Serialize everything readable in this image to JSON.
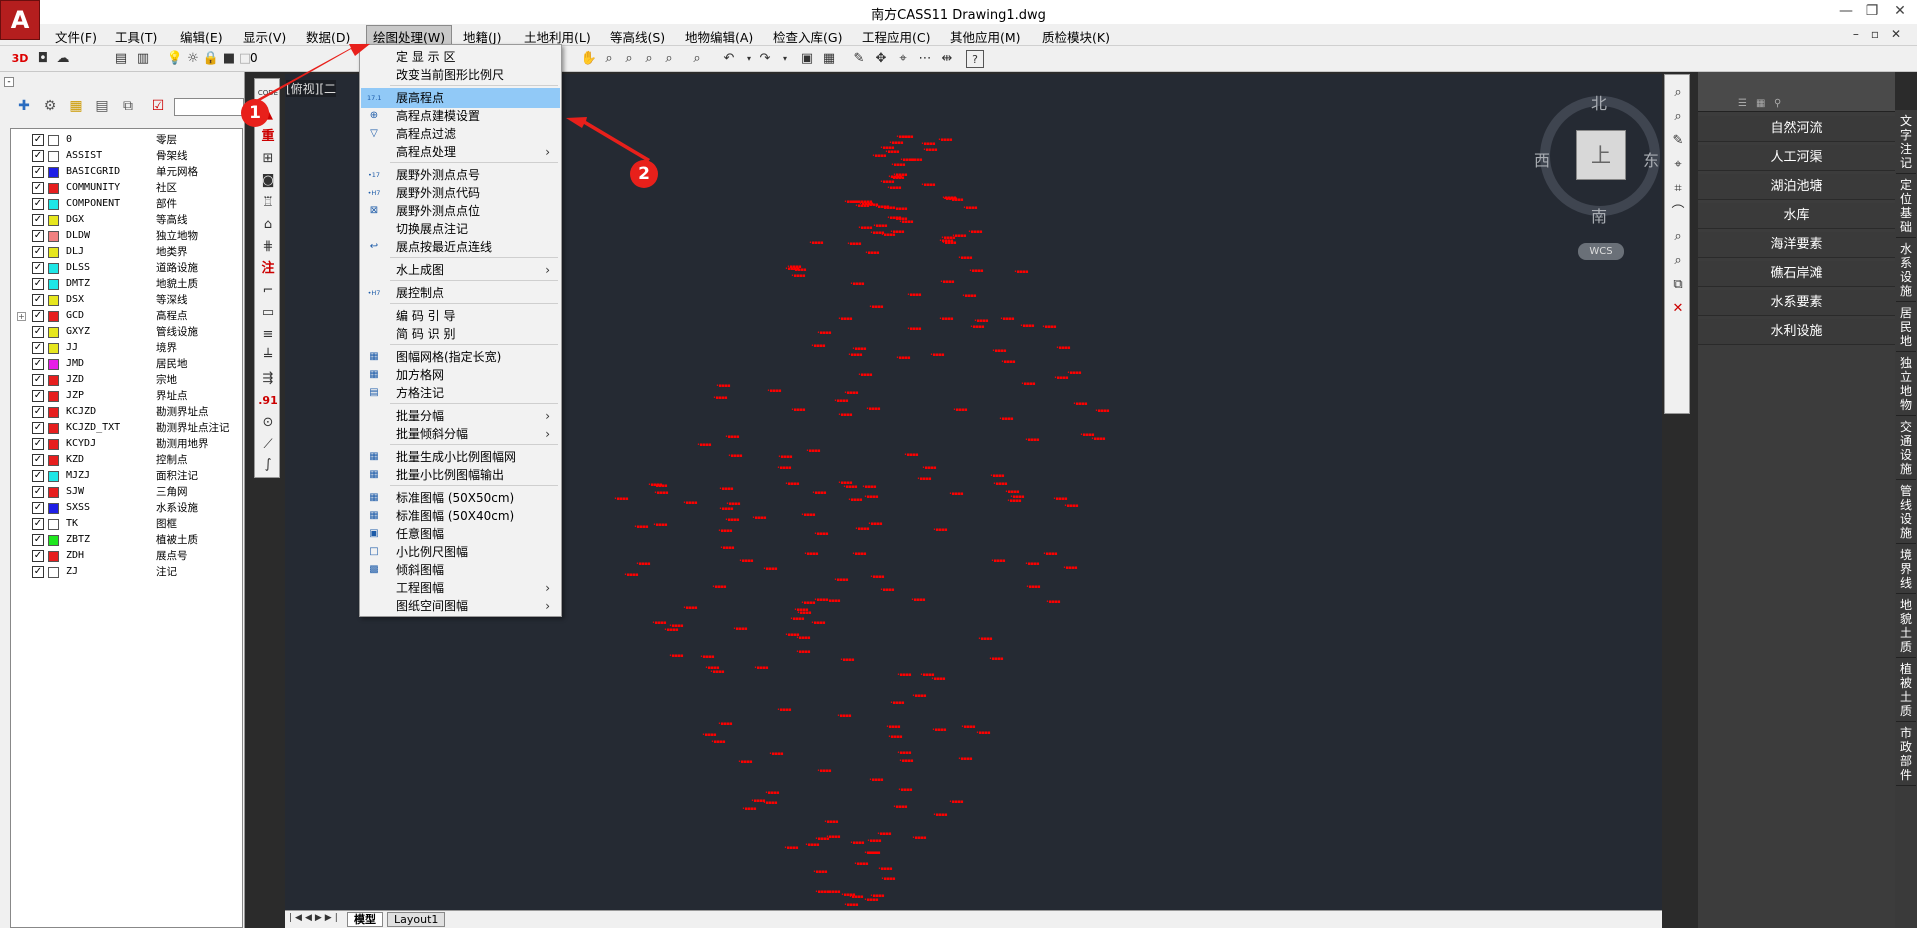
{
  "window": {
    "title": "南方CASS11    Drawing1.dwg"
  },
  "menubar": {
    "items": [
      "文件(F)",
      "工具(T)",
      "编辑(E)",
      "显示(V)",
      "数据(D)",
      "绘图处理(W)",
      "地籍(J)",
      "土地利用(L)",
      "等高线(S)",
      "地物编辑(A)",
      "检查入库(G)",
      "工程应用(C)",
      "其他应用(M)",
      "质检模块(K)"
    ],
    "active": "绘图处理(W)"
  },
  "toolbar": {
    "mode_3d": "3D",
    "layer_value": "0"
  },
  "layers": [
    {
      "name": "0",
      "desc": "零层",
      "color": "#ffffff"
    },
    {
      "name": "ASSIST",
      "desc": "骨架线",
      "color": "#ffffff"
    },
    {
      "name": "BASICGRID",
      "desc": "单元网格",
      "color": "#1e1ee6"
    },
    {
      "name": "COMMUNITY",
      "desc": "社区",
      "color": "#e61e1e"
    },
    {
      "name": "COMPONENT",
      "desc": "部件",
      "color": "#1ee6e6"
    },
    {
      "name": "DGX",
      "desc": "等高线",
      "color": "#e6e61e"
    },
    {
      "name": "DLDW",
      "desc": "独立地物",
      "color": "#f08080"
    },
    {
      "name": "DLJ",
      "desc": "地类界",
      "color": "#e6e61e"
    },
    {
      "name": "DLSS",
      "desc": "道路设施",
      "color": "#1ee6e6"
    },
    {
      "name": "DMTZ",
      "desc": "地貌土质",
      "color": "#1ee6e6"
    },
    {
      "name": "DSX",
      "desc": "等深线",
      "color": "#e6e61e"
    },
    {
      "name": "GCD",
      "desc": "高程点",
      "color": "#e61e1e"
    },
    {
      "name": "GXYZ",
      "desc": "管线设施",
      "color": "#e6e61e"
    },
    {
      "name": "JJ",
      "desc": "境界",
      "color": "#e6e61e"
    },
    {
      "name": "JMD",
      "desc": "居民地",
      "color": "#e61ee6"
    },
    {
      "name": "JZD",
      "desc": "宗地",
      "color": "#e61e1e"
    },
    {
      "name": "JZP",
      "desc": "界址点",
      "color": "#e61e1e"
    },
    {
      "name": "KCJZD",
      "desc": "勘测界址点",
      "color": "#e61e1e"
    },
    {
      "name": "KCJZD_TXT",
      "desc": "勘测界址点注记",
      "color": "#e61e1e"
    },
    {
      "name": "KCYDJ",
      "desc": "勘测用地界",
      "color": "#e61e1e"
    },
    {
      "name": "KZD",
      "desc": "控制点",
      "color": "#e61e1e"
    },
    {
      "name": "MJZJ",
      "desc": "面积注记",
      "color": "#1ee6e6"
    },
    {
      "name": "SJW",
      "desc": "三角网",
      "color": "#e61e1e"
    },
    {
      "name": "SXSS",
      "desc": "水系设施",
      "color": "#1e1ee6"
    },
    {
      "name": "TK",
      "desc": "图框",
      "color": "#ffffff"
    },
    {
      "name": "ZBTZ",
      "desc": "植被土质",
      "color": "#1ee61e"
    },
    {
      "name": "ZDH",
      "desc": "展点号",
      "color": "#e61e1e"
    },
    {
      "name": "ZJ",
      "desc": "注记",
      "color": "#ffffff"
    }
  ],
  "viewport": {
    "label": "[俯视][二"
  },
  "viewcube": {
    "north": "北",
    "south": "南",
    "east": "东",
    "west": "西",
    "face": "上",
    "wcs": "WCS"
  },
  "tabs": [
    "模型",
    "Layout1"
  ],
  "dropdown": {
    "items": [
      {
        "label": "定 显 示 区",
        "icon": "",
        "submenu": false,
        "highlight": false
      },
      {
        "label": "改变当前图形比例尺",
        "icon": "",
        "submenu": false,
        "highlight": false
      },
      {
        "sep": true
      },
      {
        "label": "展高程点",
        "icon": "17.1",
        "submenu": false,
        "highlight": true
      },
      {
        "label": "高程点建模设置",
        "icon": "⊕",
        "submenu": false,
        "highlight": false
      },
      {
        "label": "高程点过滤",
        "icon": "▽",
        "submenu": false,
        "highlight": false
      },
      {
        "label": "高程点处理",
        "icon": "",
        "submenu": true,
        "highlight": false
      },
      {
        "sep": true
      },
      {
        "label": "展野外测点点号",
        "icon": "•17",
        "submenu": false,
        "highlight": false
      },
      {
        "label": "展野外测点代码",
        "icon": "•H7",
        "submenu": false,
        "highlight": false
      },
      {
        "label": "展野外测点点位",
        "icon": "⊠",
        "submenu": false,
        "highlight": false
      },
      {
        "label": "切换展点注记",
        "icon": "",
        "submenu": false,
        "highlight": false
      },
      {
        "label": "展点按最近点连线",
        "icon": "↩",
        "submenu": false,
        "highlight": false
      },
      {
        "sep": true
      },
      {
        "label": "水上成图",
        "icon": "",
        "submenu": true,
        "highlight": false
      },
      {
        "sep": true
      },
      {
        "label": "展控制点",
        "icon": "•H7",
        "submenu": false,
        "highlight": false
      },
      {
        "sep": true
      },
      {
        "label": "编 码 引 导",
        "icon": "",
        "submenu": false,
        "highlight": false
      },
      {
        "label": "简 码 识 别",
        "icon": "",
        "submenu": false,
        "highlight": false
      },
      {
        "sep": true
      },
      {
        "label": "图幅网格(指定长宽)",
        "icon": "▦",
        "submenu": false,
        "highlight": false
      },
      {
        "label": "加方格网",
        "icon": "▦",
        "submenu": false,
        "highlight": false
      },
      {
        "label": "方格注记",
        "icon": "▤",
        "submenu": false,
        "highlight": false
      },
      {
        "sep": true
      },
      {
        "label": "批量分幅",
        "icon": "",
        "submenu": true,
        "highlight": false
      },
      {
        "label": "批量倾斜分幅",
        "icon": "",
        "submenu": true,
        "highlight": false
      },
      {
        "sep": true
      },
      {
        "label": "批量生成小比例图幅网",
        "icon": "▦",
        "submenu": false,
        "highlight": false
      },
      {
        "label": "批量小比例图幅输出",
        "icon": "▦",
        "submenu": false,
        "highlight": false
      },
      {
        "sep": true
      },
      {
        "label": "标准图幅 (50X50cm)",
        "icon": "▦",
        "submenu": false,
        "highlight": false
      },
      {
        "label": "标准图幅 (50X40cm)",
        "icon": "▦",
        "submenu": false,
        "highlight": false
      },
      {
        "label": "任意图幅",
        "icon": "▣",
        "submenu": false,
        "highlight": false
      },
      {
        "label": "小比例尺图幅",
        "icon": "□",
        "submenu": false,
        "highlight": false
      },
      {
        "label": "倾斜图幅",
        "icon": "▩",
        "submenu": false,
        "highlight": false
      },
      {
        "label": "工程图幅",
        "icon": "",
        "submenu": true,
        "highlight": false
      },
      {
        "label": "图纸空间图幅",
        "icon": "",
        "submenu": true,
        "highlight": false
      }
    ]
  },
  "right_panel": {
    "items": [
      "自然河流",
      "人工河渠",
      "湖泊池塘",
      "水库",
      "海洋要素",
      "礁石岸滩",
      "水系要素",
      "水利设施"
    ],
    "vertical_tabs": [
      "文字注记",
      "定位基础",
      "水系设施",
      "居民地",
      "独立地物",
      "交通设施",
      "管线设施",
      "境界线",
      "地貌土质",
      "植被土质",
      "市政部件"
    ]
  },
  "annotations": [
    {
      "number": "1"
    },
    {
      "number": "2"
    }
  ]
}
